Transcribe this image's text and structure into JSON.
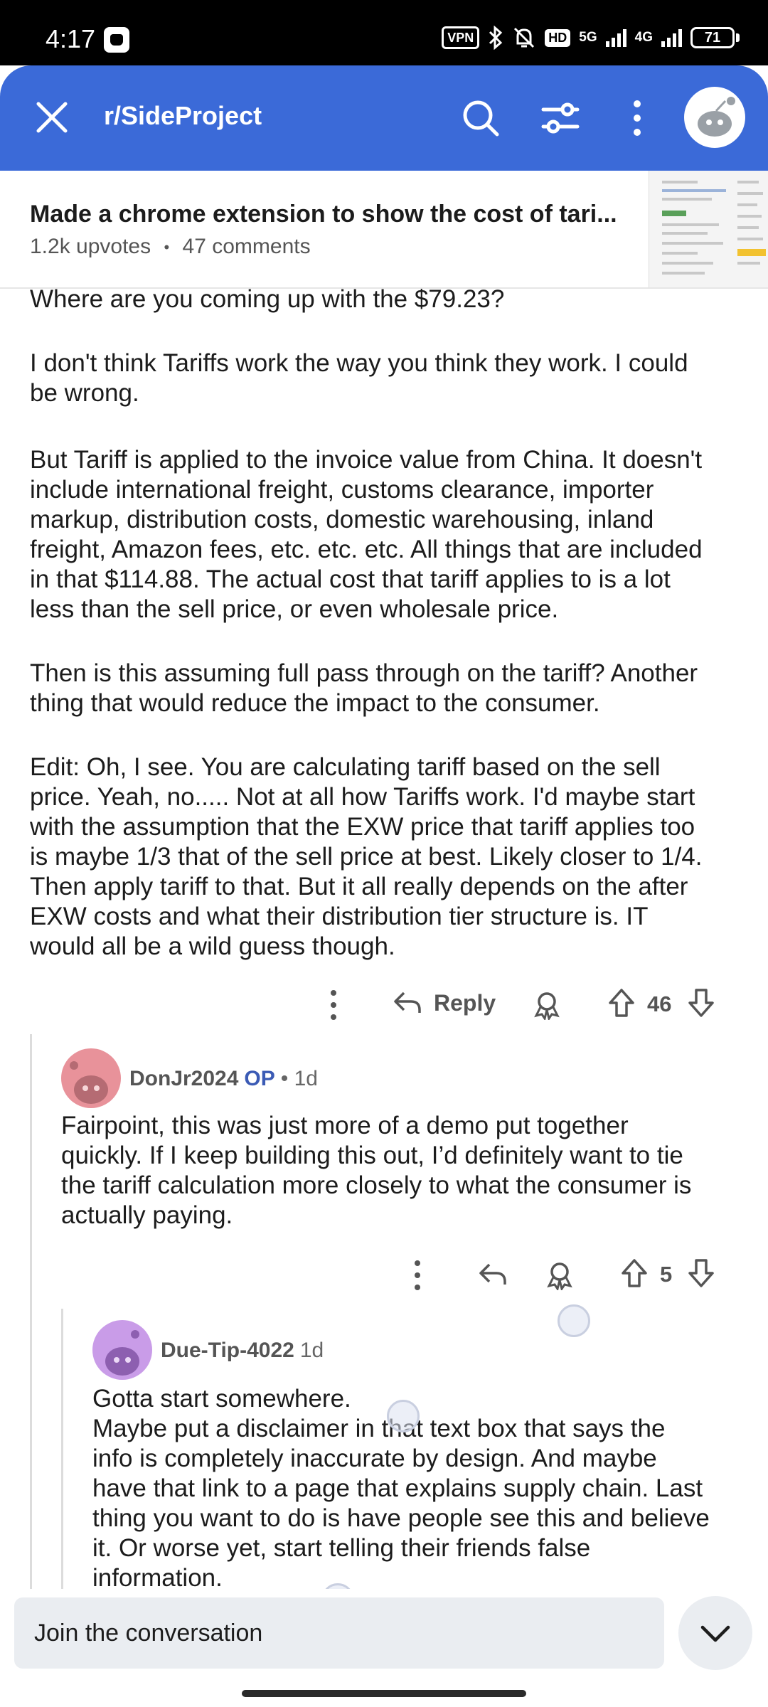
{
  "status_bar": {
    "time": "4:17",
    "vpn": "VPN",
    "hd": "HD",
    "net1": "5G",
    "net2": "4G",
    "battery": "71"
  },
  "header": {
    "subreddit": "r/SideProject",
    "accent": "#3b6ad8"
  },
  "post": {
    "title": "Made a chrome extension to show the cost of tari...",
    "upvotes": "1.2k upvotes",
    "separator": "•",
    "comments": "47 comments"
  },
  "comment_main": {
    "paragraphs": [
      "Where are you coming up with the $79.23?",
      "I don't think Tariffs work the way you think they work. I could\nbe wrong.",
      "But Tariff is applied to the invoice value from China. It doesn't\ninclude international freight, customs clearance, importer\nmarkup, distribution costs, domestic warehousing, inland\nfreight, Amazon fees, etc. etc. etc. All things that are included\nin that $114.88. The actual cost that tariff applies to is a lot\nless than the sell price, or even wholesale price.",
      "Then is this assuming full pass through on the tariff? Another\nthing that would reduce the impact to the consumer.",
      "Edit: Oh, I see. You are calculating tariff based on the sell\nprice. Yeah, no..... Not at all how Tariffs work. I'd maybe start\nwith the assumption that the EXW price that tariff applies too\nis maybe 1/3 that of the sell price at best. Likely closer to 1/4.\nThen apply tariff to that. But it all really depends on the after\nEXW costs and what their distribution tier structure is. IT\nwould all be a wild guess though."
    ],
    "reply_label": "Reply",
    "votes": "46"
  },
  "reply_1": {
    "author": "DonJr2024",
    "op_label": "OP",
    "age": "• 1d",
    "text": "Fairpoint, this was just more of a demo put together\nquickly. If I keep building this out, I’d definitely want to tie\nthe tariff calculation more closely to what the consumer is\nactually paying.",
    "votes": "5",
    "avatar_color": "#e8929a"
  },
  "reply_2": {
    "author": "Due-Tip-4022",
    "age": "1d",
    "text": "Gotta start somewhere.\nMaybe put a disclaimer in that text box that says the\ninfo is completely inaccurate by design. And maybe\nhave that link to a page that explains supply chain. Last\nthing you want to do is have people see this and believe\nit. Or worse yet, start telling their friends false\ninformation.",
    "avatar_color": "#c99ce8"
  },
  "composer": {
    "placeholder": "Join the conversation"
  }
}
